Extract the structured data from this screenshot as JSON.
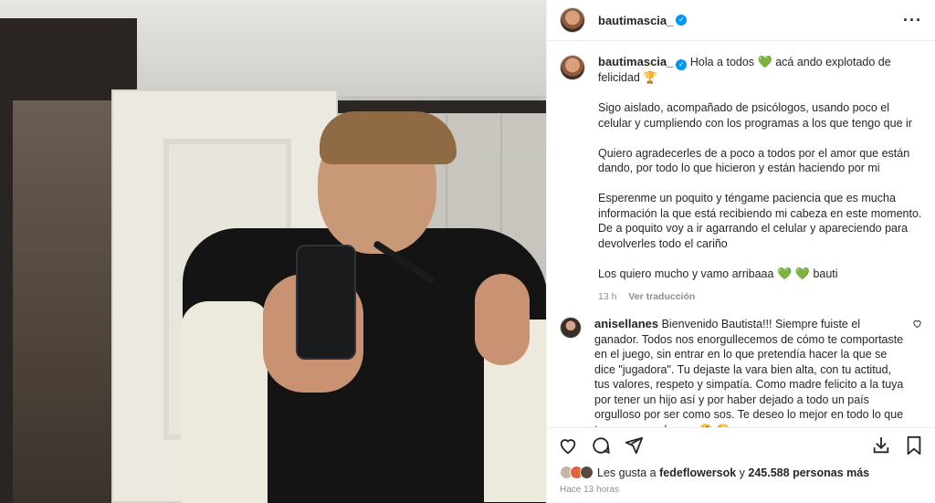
{
  "header": {
    "username": "bautimascia_"
  },
  "caption": {
    "username": "bautimascia_",
    "line1_a": "Hola a todos",
    "line1_b": "acá ando explotado de felicidad",
    "emoji_heart": "💚",
    "emoji_trophy": "🏆",
    "p1": "Sigo aislado, acompañado de psicólogos, usando poco el celular y cumpliendo con los programas a los que tengo que ir",
    "p2": "Quiero agradecerles de a poco a todos por el amor que están dando, por todo lo que hicieron y están haciendo por mi",
    "p3": "Esperenme un poquito y téngame paciencia que es mucha información la que está recibiendo mi cabeza en este momento. De a poquito voy a ir agarrando el celular y apareciendo para devolverles todo el cariño",
    "p4_a": "Los quiero mucho y vamo arribaaa",
    "p4_hearts": "💚 💚",
    "p4_b": "bauti",
    "time": "13 h",
    "translate": "Ver traducción"
  },
  "comment": {
    "username": "anisellanes",
    "text": "Bienvenido Bautista!!! Siempre fuiste el ganador. Todos nos enorgullecemos de cómo te comportaste en el juego, sin entrar en lo que pretendía hacer la que se dice \"jugadora\". Tu dejaste la vara bien alta, con tu actitud, tus valores, respeto y simpatía. Como madre felicito a la tuya por tener un hijo así y por haber dejado a todo un país orgulloso por ser como sos. Te deseo lo mejor en todo lo que te propongas hacer.",
    "emojis": "🤗 😘"
  },
  "likes": {
    "prefix": "Les gusta a",
    "user": "fedeflowersok",
    "joiner": "y",
    "count": "245.588 personas más"
  },
  "timestamp": "Hace 13 horas",
  "icons": [
    "heart-icon",
    "comment-icon",
    "share-icon",
    "download-icon",
    "bookmark-icon",
    "more-icon",
    "verified-icon"
  ],
  "colors": {
    "verified": "#0095f6",
    "heart": "#2fb863",
    "muted": "#8e8e8e"
  }
}
